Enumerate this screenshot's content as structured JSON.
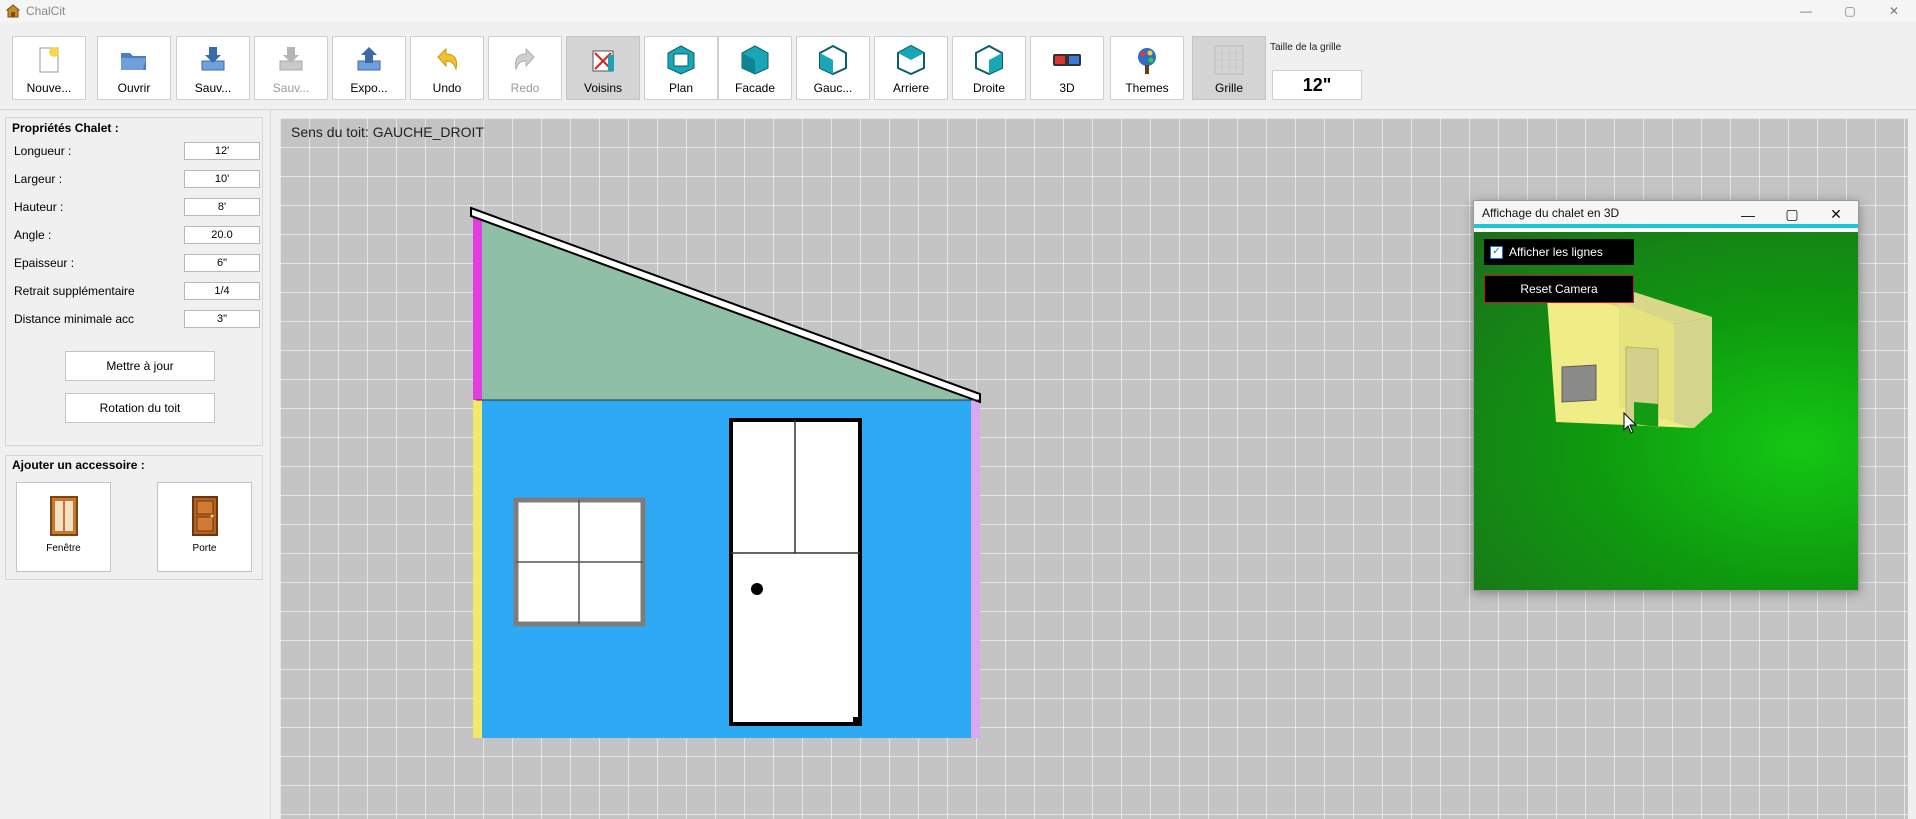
{
  "window": {
    "title": "ChalCit",
    "minimize": "—",
    "maximize": "▢",
    "close": "✕"
  },
  "toolbar": {
    "buttons": [
      {
        "label": "Nouve...",
        "icon": "new-file-icon",
        "enabled": true,
        "active": false
      },
      {
        "label": "Ouvrir",
        "icon": "folder-open-icon",
        "enabled": true,
        "active": false
      },
      {
        "label": "Sauv...",
        "icon": "save-icon",
        "enabled": true,
        "active": false
      },
      {
        "label": "Sauv...",
        "icon": "save-as-icon",
        "enabled": false,
        "active": false
      },
      {
        "label": "Expo...",
        "icon": "export-icon",
        "enabled": true,
        "active": false
      },
      {
        "label": "Undo",
        "icon": "undo-icon",
        "enabled": true,
        "active": false
      },
      {
        "label": "Redo",
        "icon": "redo-icon",
        "enabled": false,
        "active": false
      },
      {
        "label": "Voisins",
        "icon": "neighbors-icon",
        "enabled": true,
        "active": true
      },
      {
        "label": "Plan",
        "icon": "plan-view-icon",
        "enabled": true,
        "active": false
      },
      {
        "label": "Facade",
        "icon": "facade-view-icon",
        "enabled": true,
        "active": false
      },
      {
        "label": "Gauc...",
        "icon": "left-view-icon",
        "enabled": true,
        "active": false
      },
      {
        "label": "Arriere",
        "icon": "back-view-icon",
        "enabled": true,
        "active": false
      },
      {
        "label": "Droite",
        "icon": "right-view-icon",
        "enabled": true,
        "active": false
      },
      {
        "label": "3D",
        "icon": "3d-glasses-icon",
        "enabled": true,
        "active": false
      },
      {
        "label": "Themes",
        "icon": "themes-icon",
        "enabled": true,
        "active": false
      },
      {
        "label": "Grille",
        "icon": "grid-icon",
        "enabled": true,
        "active": true
      }
    ],
    "grid_size_label": "Taille de la grille",
    "grid_size_value": "12\""
  },
  "properties": {
    "title": "Propriétés Chalet :",
    "fields": [
      {
        "label": "Longueur :",
        "value": "12'"
      },
      {
        "label": "Largeur :",
        "value": "10'"
      },
      {
        "label": "Hauteur :",
        "value": "8'"
      },
      {
        "label": "Angle :",
        "value": "20.0"
      },
      {
        "label": "Epaisseur :",
        "value": "6\""
      },
      {
        "label": "Retrait supplémentaire",
        "value": "1/4"
      },
      {
        "label": "Distance minimale acc",
        "value": "3\""
      }
    ],
    "update_button": "Mettre à jour",
    "rotate_roof_button": "Rotation du toit"
  },
  "accessories": {
    "title": "Ajouter un accessoire :",
    "window_label": "Fenêtre",
    "door_label": "Porte"
  },
  "canvas": {
    "roof_direction": "Sens du toit: GAUCHE_DROIT",
    "colors": {
      "wall": "#2eaaf5",
      "gable": "#8fbfa5",
      "left_trim_top": "#e23de0",
      "left_trim_bottom": "#f2e86a",
      "right_trim": "#d8a8f0"
    }
  },
  "viewer3d": {
    "title": "Affichage du chalet en 3D",
    "show_lines_label": "Afficher les lignes",
    "show_lines_checked": true,
    "reset_camera_label": "Reset Camera",
    "minimize": "—",
    "maximize": "▢",
    "close": "✕"
  }
}
